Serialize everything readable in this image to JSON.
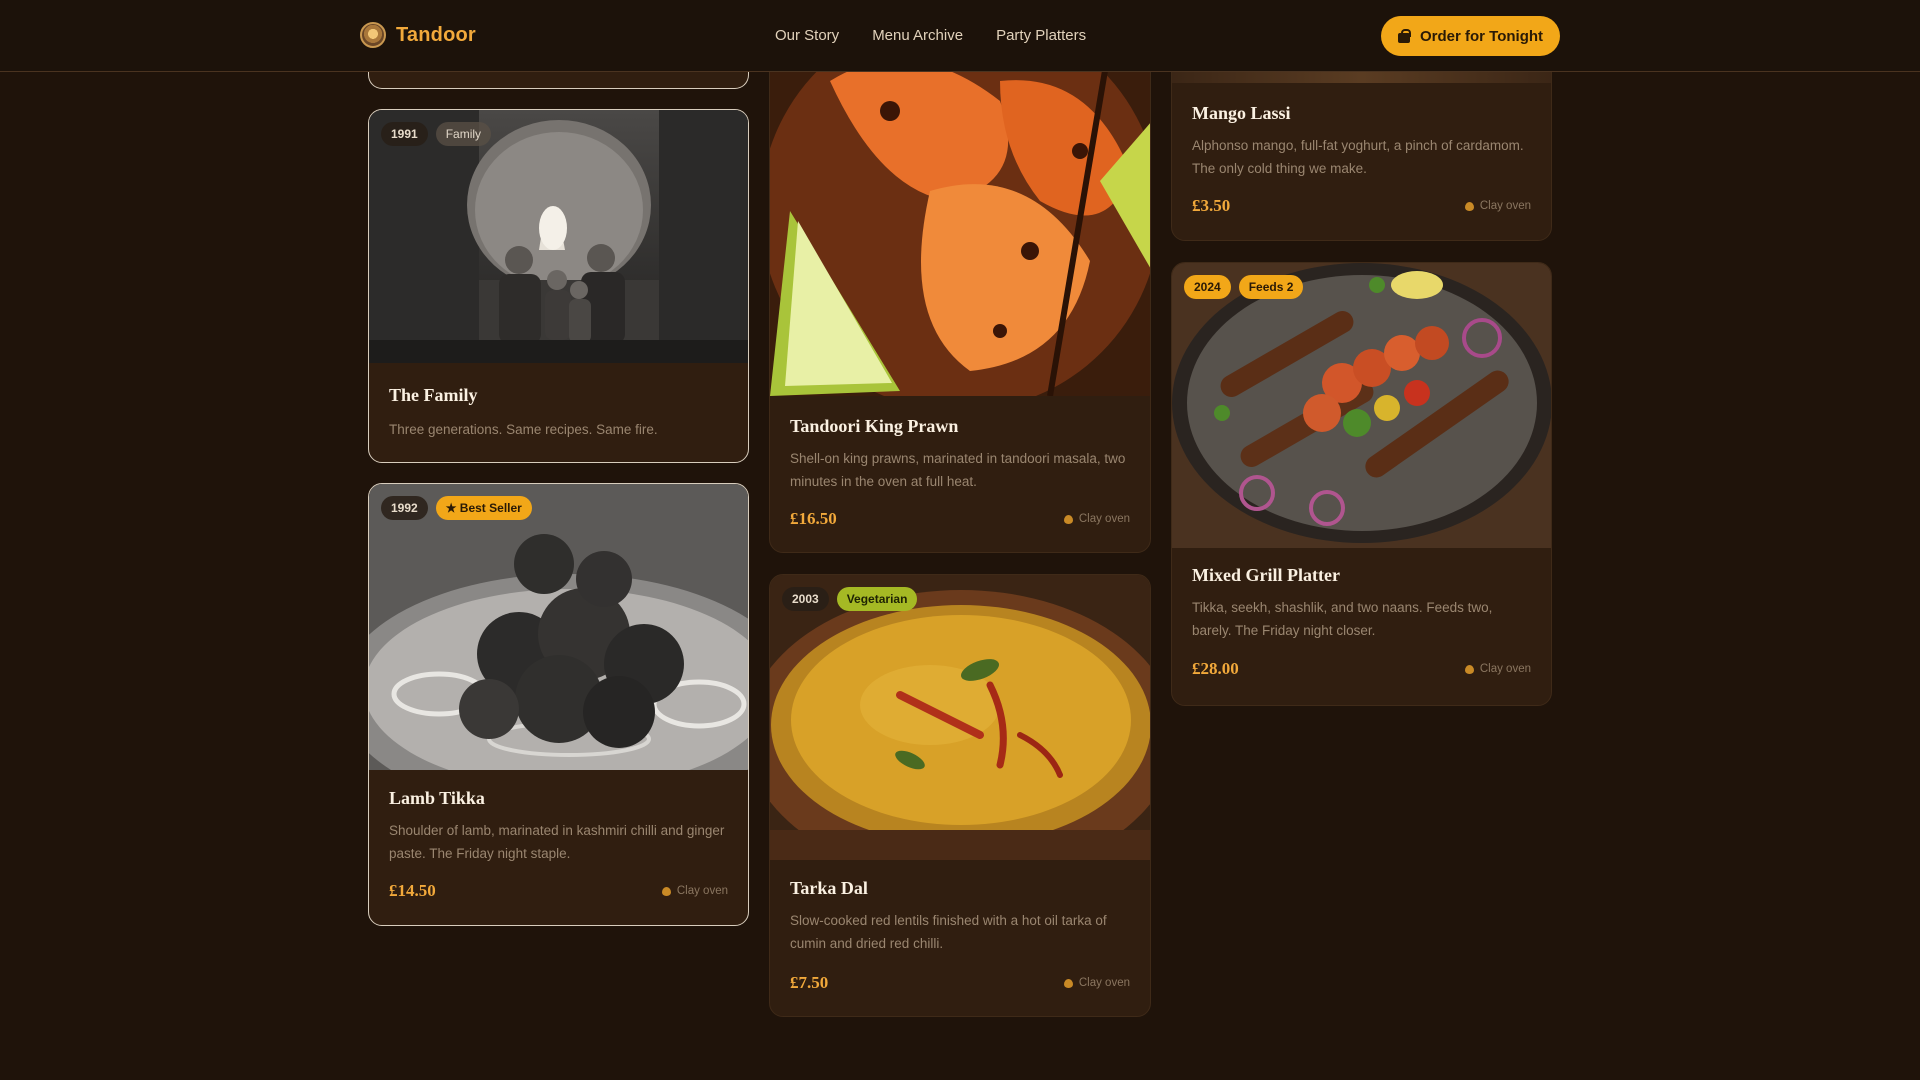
{
  "header": {
    "brand": "Tandoor",
    "nav": [
      "Our Story",
      "Menu Archive",
      "Party Platters"
    ],
    "cta": "Order for Tonight"
  },
  "cards": {
    "family": {
      "year": "1991",
      "tag": "Family",
      "title": "The Family",
      "desc": "Three generations. Same recipes. Same fire."
    },
    "lamb": {
      "year": "1992",
      "tag": "★ Best Seller",
      "title": "Lamb Tikka",
      "desc": "Shoulder of lamb, marinated in kashmiri chilli and ginger paste. The Friday night staple.",
      "price": "£14.50",
      "oven": "Clay oven"
    },
    "prawn": {
      "title": "Tandoori King Prawn",
      "desc": "Shell-on king prawns, marinated in tandoori masala, two minutes in the oven at full heat.",
      "price": "£16.50",
      "oven": "Clay oven"
    },
    "dal": {
      "year": "2003",
      "tag": "Vegetarian",
      "title": "Tarka Dal",
      "desc": "Slow-cooked red lentils finished with a hot oil tarka of cumin and dried red chilli.",
      "price": "£7.50",
      "oven": "Clay oven"
    },
    "lassi": {
      "title": "Mango Lassi",
      "desc": "Alphonso mango, full-fat yoghurt, a pinch of cardamom. The only cold thing we make.",
      "price": "£3.50",
      "oven": "Clay oven"
    },
    "grill": {
      "year": "2024",
      "tag": "Feeds 2",
      "title": "Mixed Grill Platter",
      "desc": "Tikka, seekh, shashlik, and two naans. Feeds two, barely. The Friday night closer.",
      "price": "£28.00",
      "oven": "Clay oven"
    }
  },
  "colors": {
    "background": "#1f130a",
    "accent": "#f2a718",
    "price": "#f2a93b",
    "vegetarian": "#a5b924"
  }
}
